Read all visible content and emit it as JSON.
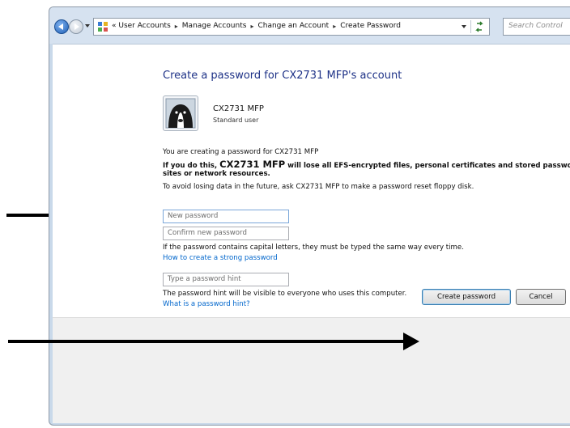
{
  "address_bar": {
    "breadcrumbs": [
      {
        "label": "« User Accounts"
      },
      {
        "label": "Manage Accounts"
      },
      {
        "label": "Change an Account"
      },
      {
        "label": "Create Password"
      }
    ],
    "search_placeholder": "Search Control"
  },
  "page": {
    "title": "Create a password for CX2731 MFP's account",
    "user_name": "CX2731 MFP",
    "user_role": "Standard user",
    "info_line": "You are creating a password for CX2731 MFP",
    "warning_prefix": "If you do this, ",
    "warning_user": "CX2731 MFP",
    "warning_rest": " will lose all EFS-encrypted files, personal certificates and stored passwords f",
    "warning_line2": "sites or network resources.",
    "avoid_prefix": "To avoid losing data in the future, ask ",
    "avoid_user": "CX2731 MFP",
    "avoid_rest": " to make a password reset floppy disk.",
    "new_password_placeholder": "New password",
    "confirm_password_placeholder": "Confirm new password",
    "capital_note": "If the password contains capital letters, they must be typed the same way every time.",
    "strong_password_link": "How to create a strong password",
    "hint_placeholder": "Type a password hint",
    "hint_note": "The password hint will be visible to everyone who uses this computer.",
    "hint_link": "What is a password hint?"
  },
  "buttons": {
    "create": "Create password",
    "cancel": "Cancel"
  },
  "icons": {
    "back": "back-arrow-icon",
    "forward": "forward-arrow-icon",
    "control_panel": "control-panel-icon",
    "refresh": "refresh-icon",
    "avatar": "dog-avatar-icon"
  }
}
